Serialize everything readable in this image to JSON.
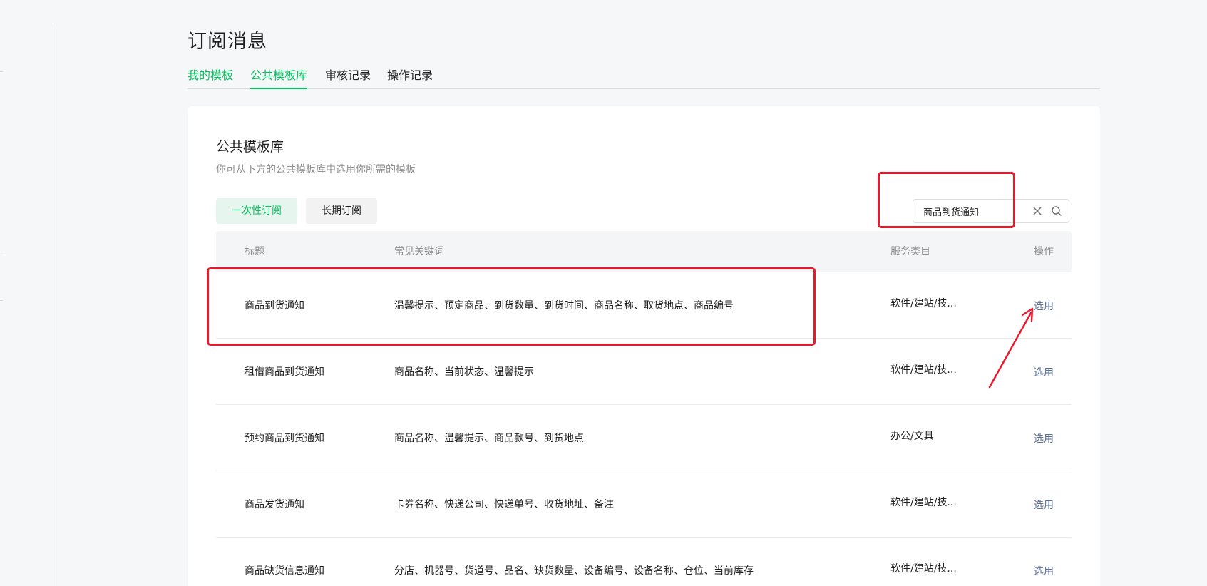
{
  "page": {
    "title": "订阅消息",
    "tabs": [
      {
        "label": "我的模板"
      },
      {
        "label": "公共模板库"
      },
      {
        "label": "审核记录"
      },
      {
        "label": "操作记录"
      }
    ]
  },
  "library": {
    "title": "公共模板库",
    "description": "你可从下方的公共模板库中选用你所需的模板",
    "filters": [
      {
        "label": "一次性订阅"
      },
      {
        "label": "长期订阅"
      }
    ],
    "search": {
      "value": "商品到货通知"
    }
  },
  "table": {
    "headers": [
      "标题",
      "常见关键词",
      "服务类目",
      "操作"
    ],
    "rows": [
      {
        "title": "商品到货通知",
        "keywords": "温馨提示、预定商品、到货数量、到货时间、商品名称、取货地点、商品编号",
        "category": "软件/建站/技...",
        "action": "选用"
      },
      {
        "title": "租借商品到货通知",
        "keywords": "商品名称、当前状态、温馨提示",
        "category": "软件/建站/技...",
        "action": "选用"
      },
      {
        "title": "预约商品到货通知",
        "keywords": "商品名称、温馨提示、商品款号、到货地点",
        "category": "办公/文具",
        "action": "选用"
      },
      {
        "title": "商品发货通知",
        "keywords": "卡券名称、快递公司、快递单号、收货地址、备注",
        "category": "软件/建站/技...",
        "action": "选用"
      },
      {
        "title": "商品缺货信息通知",
        "keywords": "分店、机器号、货道号、品名、缺货数量、设备编号、设备名称、仓位、当前库存",
        "category": "软件/建站/技...",
        "action": "选用"
      }
    ]
  },
  "colors": {
    "accent": "#07c160",
    "link": "#576b95",
    "annotation": "#e8192c"
  },
  "icons": {
    "clear": "close-icon",
    "search": "search-icon"
  }
}
